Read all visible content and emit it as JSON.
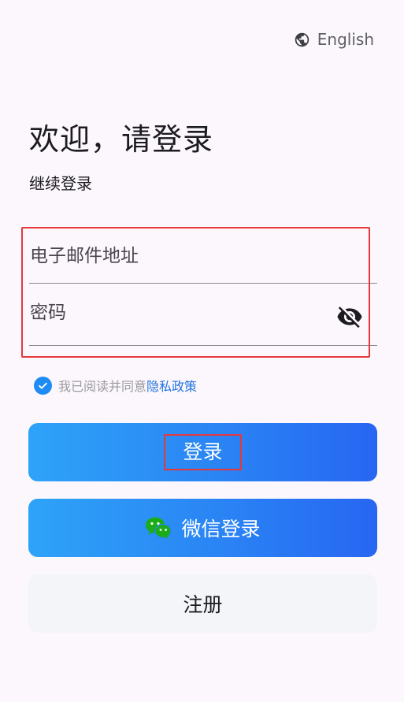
{
  "language": {
    "label": "English",
    "icon": "globe-icon"
  },
  "header": {
    "title": "欢迎，请登录",
    "subtitle": "继续登录"
  },
  "form": {
    "email_placeholder": "电子邮件地址",
    "password_placeholder": "密码",
    "password_visibility_icon": "eye-off-icon"
  },
  "agreement": {
    "checked": true,
    "text": "我已阅读并同意",
    "link_text": "隐私政策"
  },
  "buttons": {
    "login": "登录",
    "wechat_login": "微信登录",
    "register": "注册"
  },
  "colors": {
    "accent": "#2a84f4",
    "highlight": "#e5383b",
    "wechat": "#1aad19",
    "link": "#2374e1"
  }
}
